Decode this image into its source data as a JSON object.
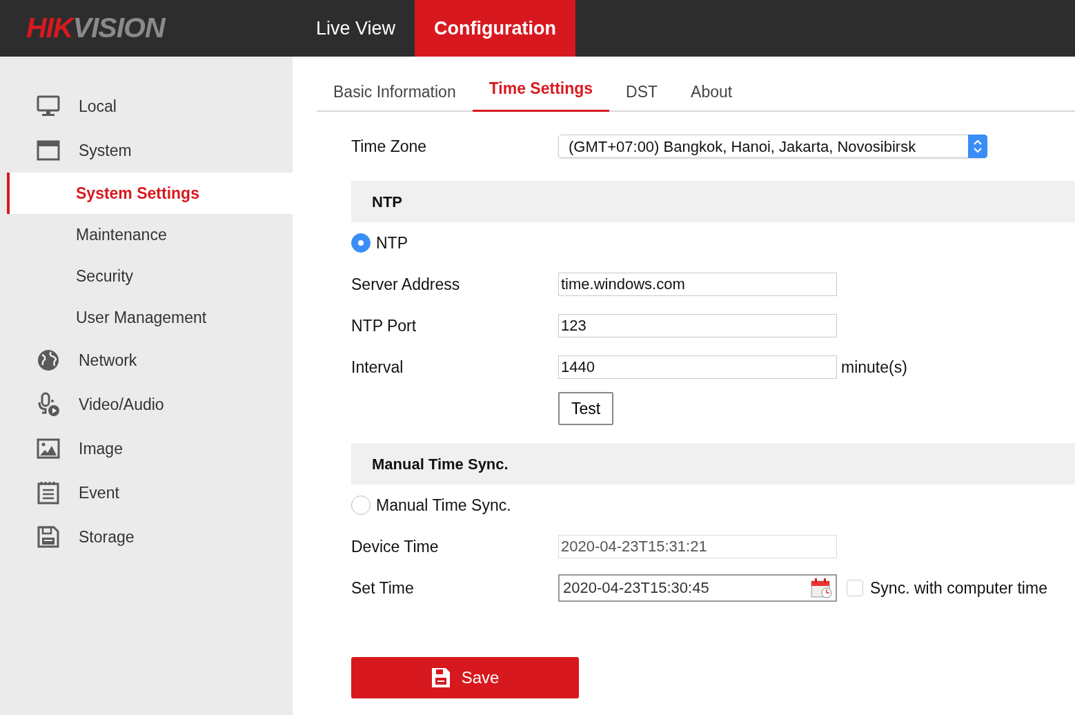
{
  "header": {
    "logo": {
      "part_1": "HIK",
      "part_2": "VISION"
    },
    "nav": [
      {
        "label": "Live View",
        "selected": false
      },
      {
        "label": "Configuration",
        "selected": true
      }
    ]
  },
  "sidebar": {
    "items": [
      {
        "label": "Local",
        "selected": false
      },
      {
        "label": "System",
        "selected": false,
        "children": [
          {
            "label": "System Settings",
            "selected": true
          },
          {
            "label": "Maintenance",
            "selected": false
          },
          {
            "label": "Security",
            "selected": false
          },
          {
            "label": "User Management",
            "selected": false
          }
        ]
      },
      {
        "label": "Network",
        "selected": false
      },
      {
        "label": "Video/Audio",
        "selected": false
      },
      {
        "label": "Image",
        "selected": false
      },
      {
        "label": "Event",
        "selected": false
      },
      {
        "label": "Storage",
        "selected": false
      }
    ]
  },
  "tabs": [
    {
      "label": "Basic Information",
      "selected": false
    },
    {
      "label": "Time Settings",
      "selected": true
    },
    {
      "label": "DST",
      "selected": false
    },
    {
      "label": "About",
      "selected": false
    }
  ],
  "time_zone": {
    "label": "Time Zone",
    "value": "(GMT+07:00) Bangkok, Hanoi, Jakarta, Novosibirsk"
  },
  "sections": [
    {
      "title": "NTP",
      "mode": {
        "label": "NTP",
        "selected": true
      },
      "rows": [
        {
          "kind": "text",
          "label": "Server Address",
          "value": "time.windows.com"
        },
        {
          "kind": "text",
          "label": "NTP Port",
          "value": "123"
        },
        {
          "kind": "text",
          "label": "Interval",
          "value": "1440",
          "unit": "minute(s)"
        },
        {
          "kind": "button",
          "label": "Test"
        }
      ]
    },
    {
      "title": "Manual Time Sync.",
      "mode": {
        "label": "Manual Time Sync.",
        "selected": false
      },
      "rows": [
        {
          "kind": "readonly",
          "label": "Device Time",
          "value": "2020-04-23T15:31:21"
        },
        {
          "kind": "datetime",
          "label": "Set Time",
          "value": "2020-04-23T15:30:45",
          "checkbox": {
            "label": "Sync. with computer time",
            "checked": false
          }
        }
      ]
    }
  ],
  "save_button": {
    "label": "Save"
  }
}
